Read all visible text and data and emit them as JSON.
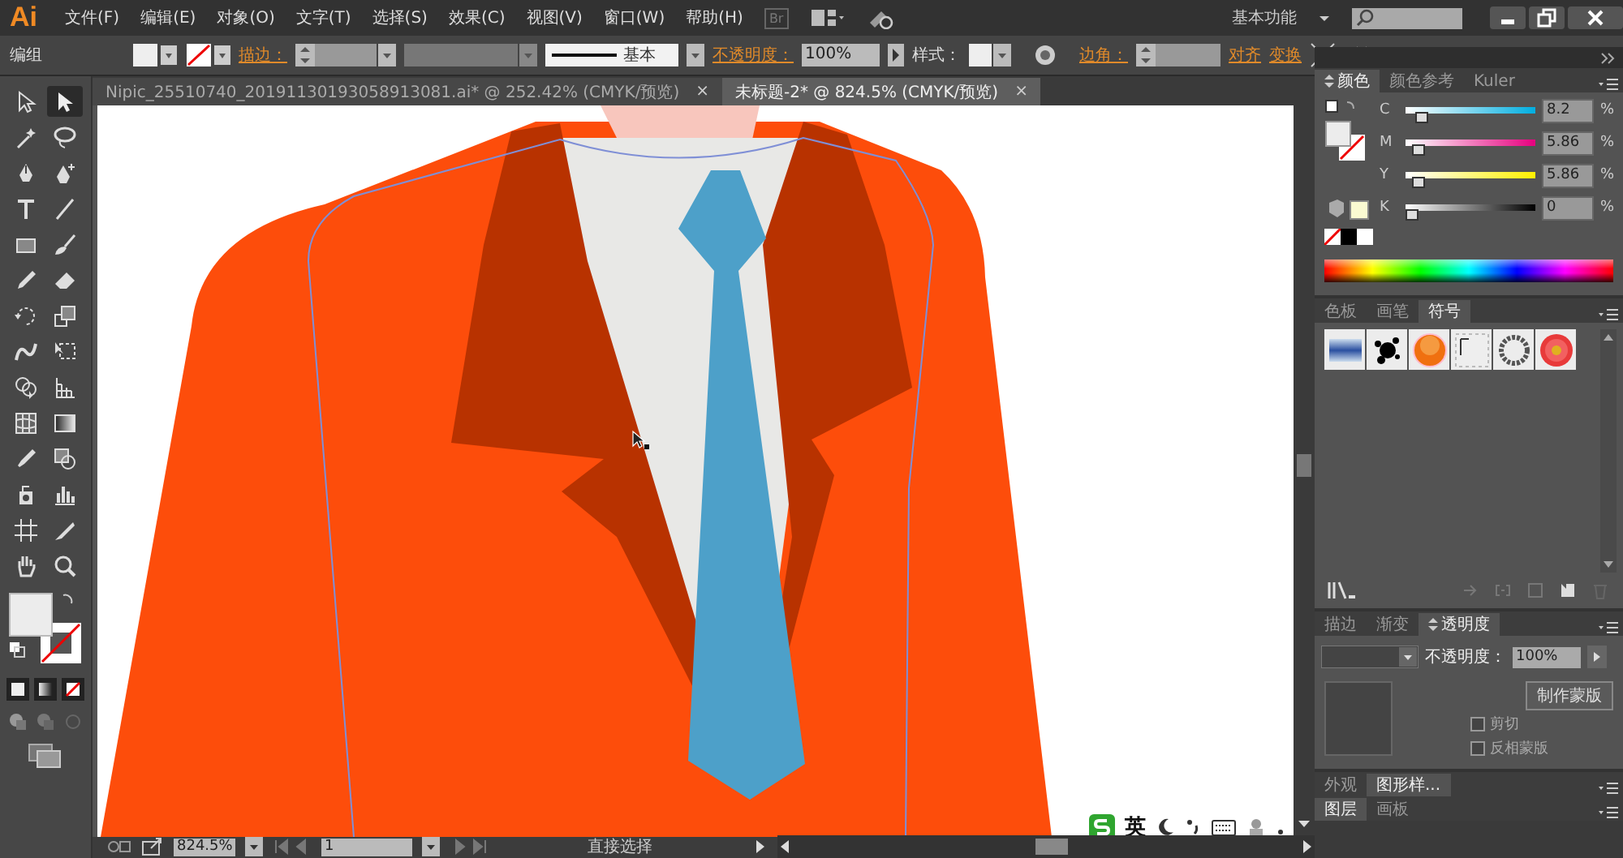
{
  "app_logo": "Ai",
  "menu": [
    "文件(F)",
    "编辑(E)",
    "对象(O)",
    "文字(T)",
    "选择(S)",
    "效果(C)",
    "视图(V)",
    "窗口(W)",
    "帮助(H)"
  ],
  "bridge_button": "Br",
  "workspace": "基本功能",
  "control_bar": {
    "selection_label": "编组",
    "stroke_label": "描边：",
    "stroke_profile": "基本",
    "opacity_label": "不透明度：",
    "opacity_value": "100%",
    "style_label": "样式：",
    "corner_label": "边角：",
    "align_link": "对齐",
    "transform_link": "变换"
  },
  "documents": [
    {
      "title": "Nipic_25510740_20191130193058913081.ai* @ 252.42% (CMYK/预览)",
      "close": "×",
      "selected": false
    },
    {
      "title": "未标题-2* @ 824.5% (CMYK/预览)",
      "close": "×",
      "selected": true
    }
  ],
  "tools": [
    {
      "kind": "select",
      "selected": false
    },
    {
      "kind": "direct-select",
      "selected": true
    },
    {
      "kind": "wand",
      "selected": false
    },
    {
      "kind": "lasso",
      "selected": false
    },
    {
      "kind": "pen",
      "selected": false
    },
    {
      "kind": "pen-plus",
      "selected": false
    },
    {
      "kind": "type",
      "selected": false
    },
    {
      "kind": "line",
      "selected": false
    },
    {
      "kind": "rect",
      "selected": false
    },
    {
      "kind": "brush",
      "selected": false
    },
    {
      "kind": "pencil",
      "selected": false
    },
    {
      "kind": "eraser",
      "selected": false
    },
    {
      "kind": "rotate",
      "selected": false
    },
    {
      "kind": "scale",
      "selected": false
    },
    {
      "kind": "warp",
      "selected": false
    },
    {
      "kind": "transform",
      "selected": false
    },
    {
      "kind": "shape-builder",
      "selected": false
    },
    {
      "kind": "perspective",
      "selected": false
    },
    {
      "kind": "mesh",
      "selected": false
    },
    {
      "kind": "gradient",
      "selected": false
    },
    {
      "kind": "eyedropper",
      "selected": false
    },
    {
      "kind": "blend",
      "selected": false
    },
    {
      "kind": "sprayer",
      "selected": false
    },
    {
      "kind": "graph",
      "selected": false
    },
    {
      "kind": "artboard",
      "selected": false
    },
    {
      "kind": "slice",
      "selected": false
    },
    {
      "kind": "hand",
      "selected": false
    },
    {
      "kind": "zoom",
      "selected": false
    }
  ],
  "color_panel": {
    "tabs": [
      {
        "label": "颜色",
        "selected": true
      },
      {
        "label": "颜色参考",
        "selected": false
      },
      {
        "label": "Kuler",
        "selected": false
      }
    ],
    "channels": [
      {
        "name": "C",
        "kind": "cyan",
        "level": 0.082,
        "value": "8.2",
        "unit": "%"
      },
      {
        "name": "M",
        "kind": "magenta",
        "level": 0.0586,
        "value": "5.86",
        "unit": "%"
      },
      {
        "name": "Y",
        "kind": "yellow",
        "level": 0.0586,
        "value": "5.86",
        "unit": "%"
      },
      {
        "name": "K",
        "kind": "black",
        "level": 0,
        "value": "0",
        "unit": "%"
      }
    ]
  },
  "symbols_panel": {
    "tabs": [
      {
        "label": "色板",
        "selected": false
      },
      {
        "label": "画笔",
        "selected": false
      },
      {
        "label": "符号",
        "selected": true
      }
    ],
    "symbols": [
      {
        "kind": "banner"
      },
      {
        "kind": "splat"
      },
      {
        "kind": "orb"
      },
      {
        "kind": "frame"
      },
      {
        "kind": "ring"
      },
      {
        "kind": "flower"
      }
    ]
  },
  "transparency_panel": {
    "tabs": [
      {
        "label": "描边",
        "selected": false
      },
      {
        "label": "渐变",
        "selected": false
      },
      {
        "label": "透明度",
        "selected": true
      }
    ],
    "opacity_label": "不透明度：",
    "opacity_value": "100%",
    "mask_button": "制作蒙版",
    "options": [
      {
        "label": "剪切",
        "checked": false
      },
      {
        "label": "反相蒙版",
        "checked": false
      }
    ]
  },
  "appearance_panel": {
    "tabs": [
      {
        "label": "外观",
        "selected": false
      },
      {
        "label": "图形样...",
        "selected": true
      }
    ]
  },
  "layers_panel": {
    "tabs": [
      {
        "label": "图层",
        "selected": true
      },
      {
        "label": "画板",
        "selected": false
      }
    ]
  },
  "status_bar": {
    "zoom": "824.5%",
    "artboard": "1",
    "tool_status": "直接选择"
  },
  "ime_toolbar": {
    "mode": "英"
  }
}
